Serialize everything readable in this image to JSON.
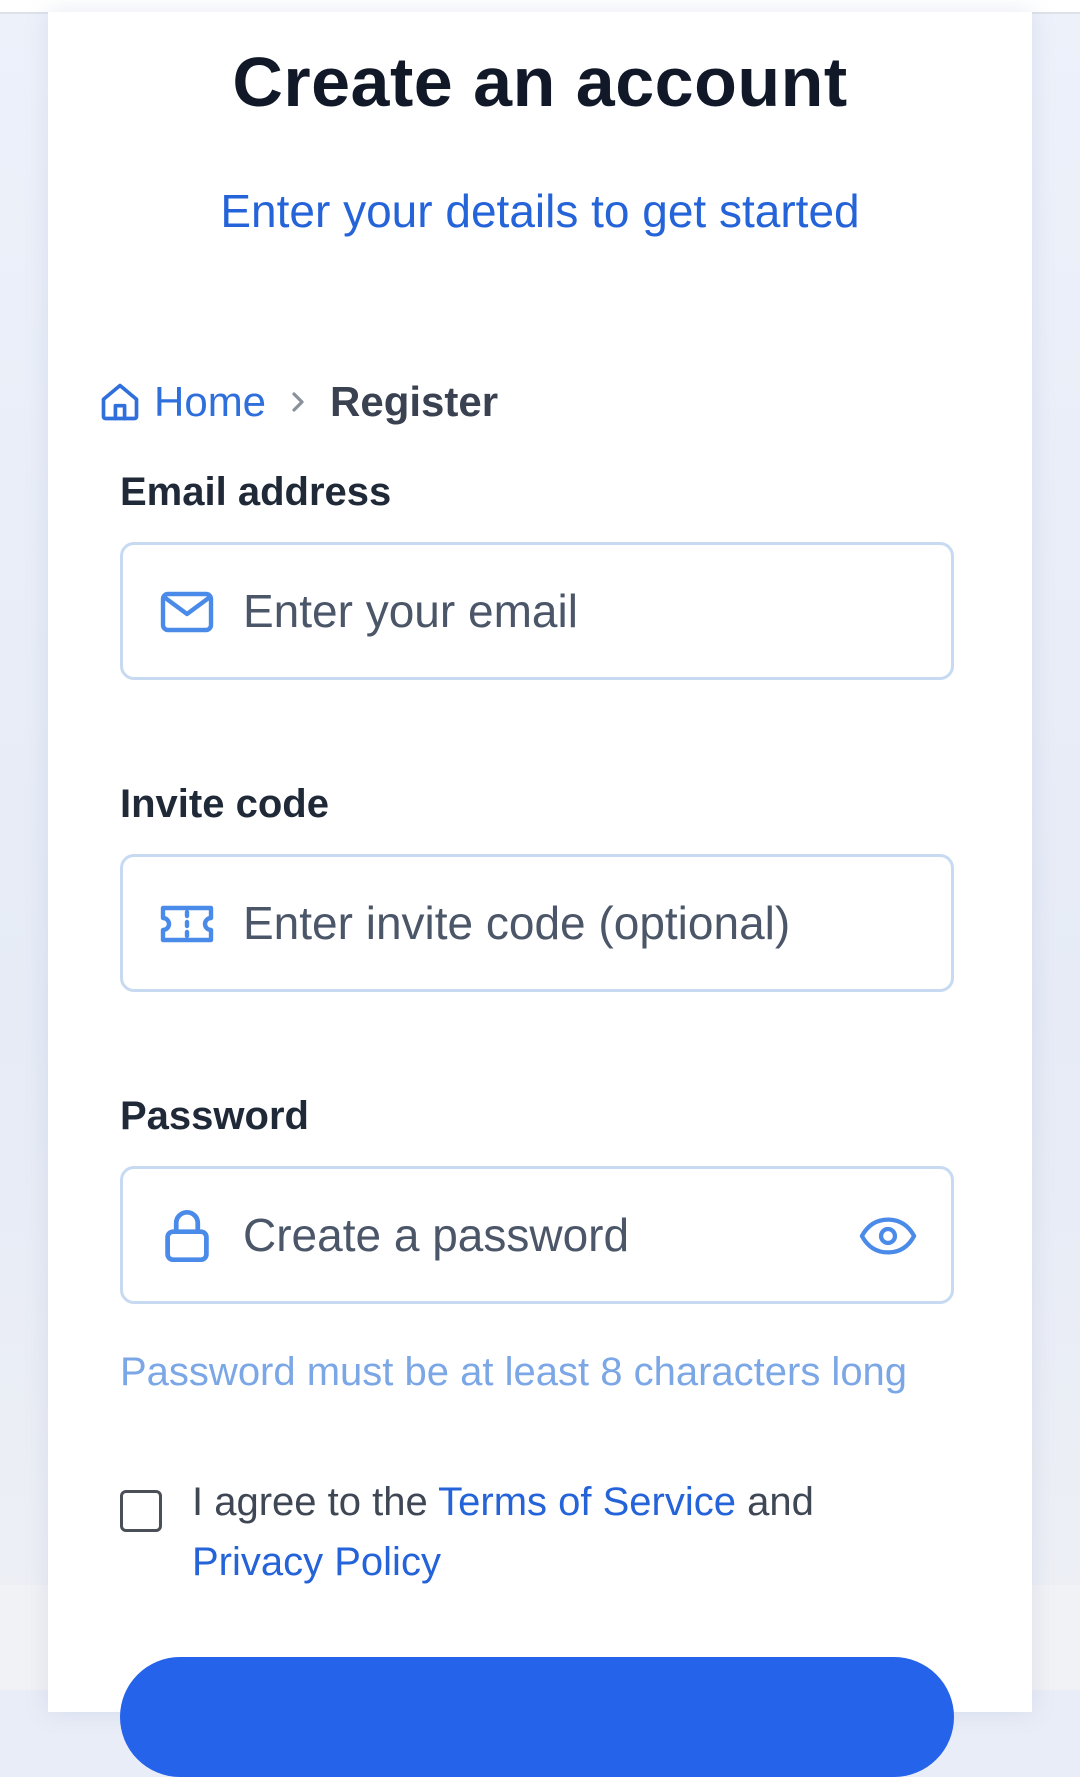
{
  "header": {
    "title": "Create an account",
    "subtitle": "Enter your details to get started"
  },
  "breadcrumb": {
    "home_label": "Home",
    "home_icon": "home-icon",
    "separator_icon": "chevron-right-icon",
    "current_label": "Register"
  },
  "form": {
    "email": {
      "label": "Email address",
      "placeholder": "Enter your email",
      "value": "",
      "icon": "mail-icon"
    },
    "invite": {
      "label": "Invite code",
      "placeholder": "Enter invite code (optional)",
      "value": "",
      "icon": "ticket-icon"
    },
    "password": {
      "label": "Password",
      "placeholder": "Create a password",
      "value": "",
      "icon": "lock-icon",
      "toggle_icon": "eye-icon",
      "hint": "Password must be at least 8 characters long"
    },
    "agree": {
      "checked": false,
      "prefix": "I agree to the ",
      "terms_label": "Terms of Service",
      "middle": " and",
      "privacy_label": "Privacy Policy"
    }
  },
  "colors": {
    "accent": "#2563eb",
    "link": "#2563d9",
    "field_border": "#c7daf2",
    "hint": "#7ba7e6",
    "title": "#111827"
  }
}
